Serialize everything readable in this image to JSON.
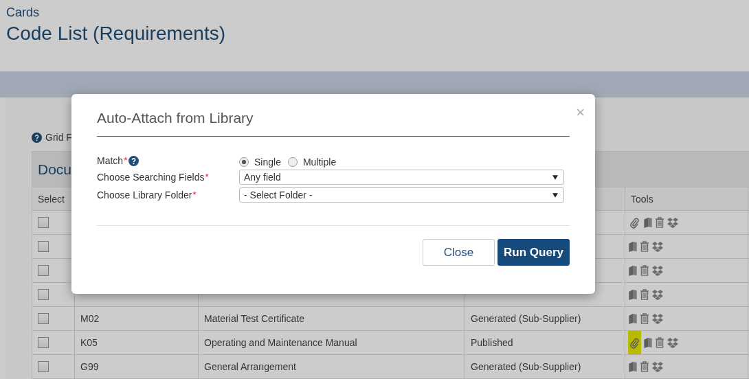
{
  "page": {
    "breadcrumb": "Cards",
    "title": "Code List (Requirements)",
    "help_link": "Grid F",
    "panel_title": "Docu"
  },
  "table": {
    "columns": [
      "Select",
      "Tools"
    ],
    "rows": [
      {
        "checked": false,
        "attachment": true,
        "highlighted": false
      },
      {
        "checked": false,
        "attachment": false,
        "highlighted": false
      },
      {
        "checked": false,
        "attachment": false,
        "highlighted": false
      },
      {
        "checked": false,
        "attachment": false,
        "highlighted": false
      },
      {
        "checked": false,
        "code": "M02",
        "title": "Material Test Certificate",
        "status": "Generated (Sub-Supplier)",
        "attachment": false,
        "highlighted": false
      },
      {
        "checked": false,
        "code": "K05",
        "title": "Operating and Maintenance Manual",
        "status": "Published",
        "attachment": true,
        "highlighted": true
      },
      {
        "checked": false,
        "code": "G99",
        "title": "General Arrangement",
        "status": "Generated (Sub-Supplier)",
        "attachment": false,
        "highlighted": false
      }
    ]
  },
  "dialog": {
    "title": "Auto-Attach from Library",
    "close_icon": "×",
    "match": {
      "label": "Match",
      "required": "*",
      "options": [
        {
          "label": "Single",
          "selected": true
        },
        {
          "label": "Multiple",
          "selected": false
        }
      ]
    },
    "fields": [
      {
        "label": "Choose Searching Fields",
        "required": "*",
        "value": "Any field"
      },
      {
        "label": "Choose Library Folder",
        "required": "*",
        "value": "- Select Folder -"
      }
    ],
    "buttons": [
      {
        "label": "Close",
        "kind": "secondary"
      },
      {
        "label": "Run Query",
        "kind": "primary"
      }
    ]
  }
}
